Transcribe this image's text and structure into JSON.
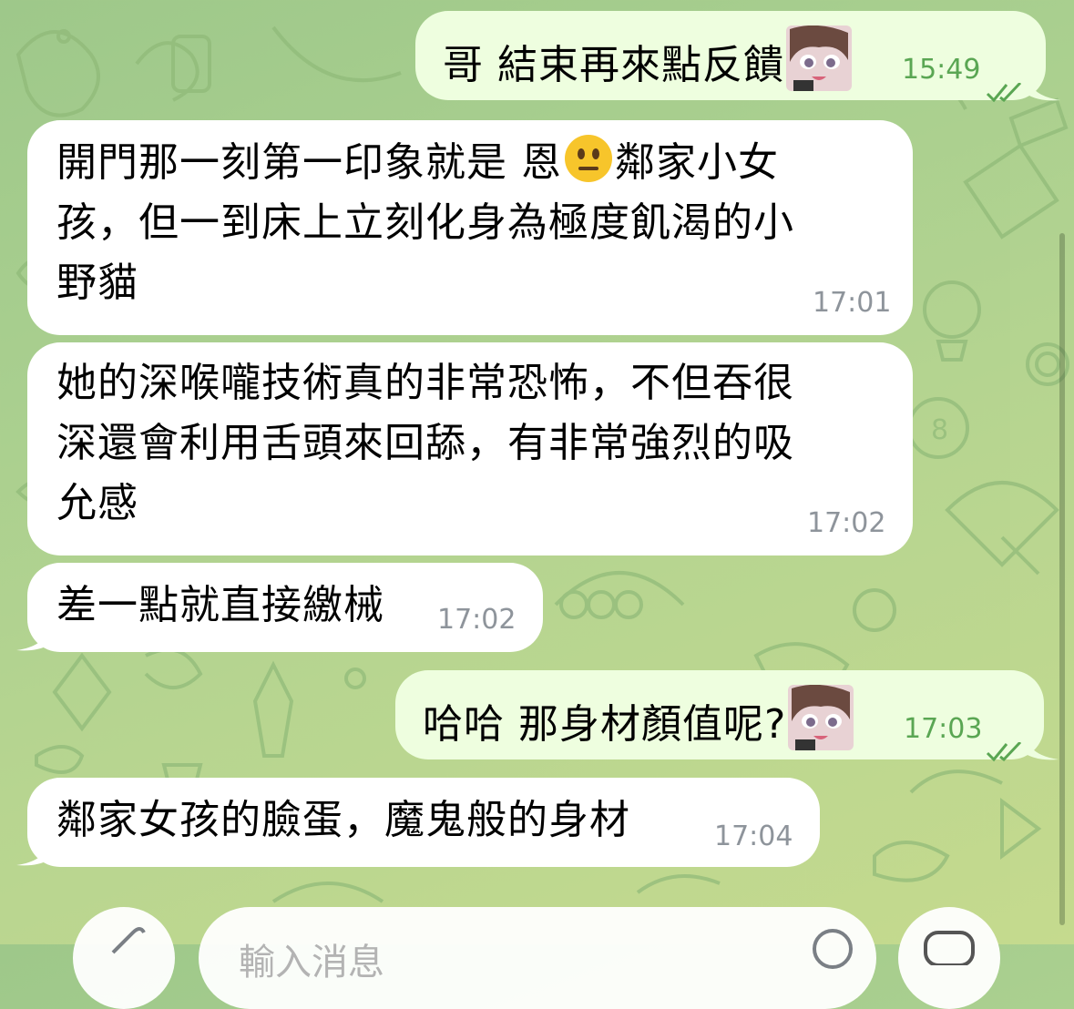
{
  "chat": {
    "messages": [
      {
        "direction": "outgoing",
        "lines": [
          "哥 結束再來點反饋"
        ],
        "time": "15:49",
        "read": true,
        "sticker": "avatar-sticker"
      },
      {
        "direction": "incoming",
        "lines": [
          "開門那一刻第一印象就是 恩",
          "鄰家小女",
          "孩，但一到床上立刻化身為極度飢渴的小",
          "野貓"
        ],
        "emoji": "neutral-face-emoji",
        "time": "17:01"
      },
      {
        "direction": "incoming",
        "lines": [
          "她的深喉嚨技術真的非常恐怖，不但吞很",
          "深還會利用舌頭來回舔，有非常強烈的吸",
          "允感"
        ],
        "time": "17:02"
      },
      {
        "direction": "incoming",
        "lines": [
          "差一點就直接繳械"
        ],
        "time": "17:02"
      },
      {
        "direction": "outgoing",
        "lines": [
          "哈哈 那身材顏值呢?"
        ],
        "time": "17:03",
        "read": true,
        "sticker": "avatar-sticker"
      },
      {
        "direction": "incoming",
        "lines": [
          "鄰家女孩的臉蛋，魔鬼般的身材"
        ],
        "time": "17:04"
      }
    ]
  },
  "input": {
    "placeholder": "輸入消息",
    "attach_icon": "paperclip-icon",
    "emoji_icon": "emoji-icon",
    "voice_icon": "microphone-icon"
  },
  "colors": {
    "incoming_bubble": "#ffffff",
    "outgoing_bubble": "#eefedf",
    "outgoing_time": "#5aa653",
    "incoming_time": "#8e949b"
  }
}
